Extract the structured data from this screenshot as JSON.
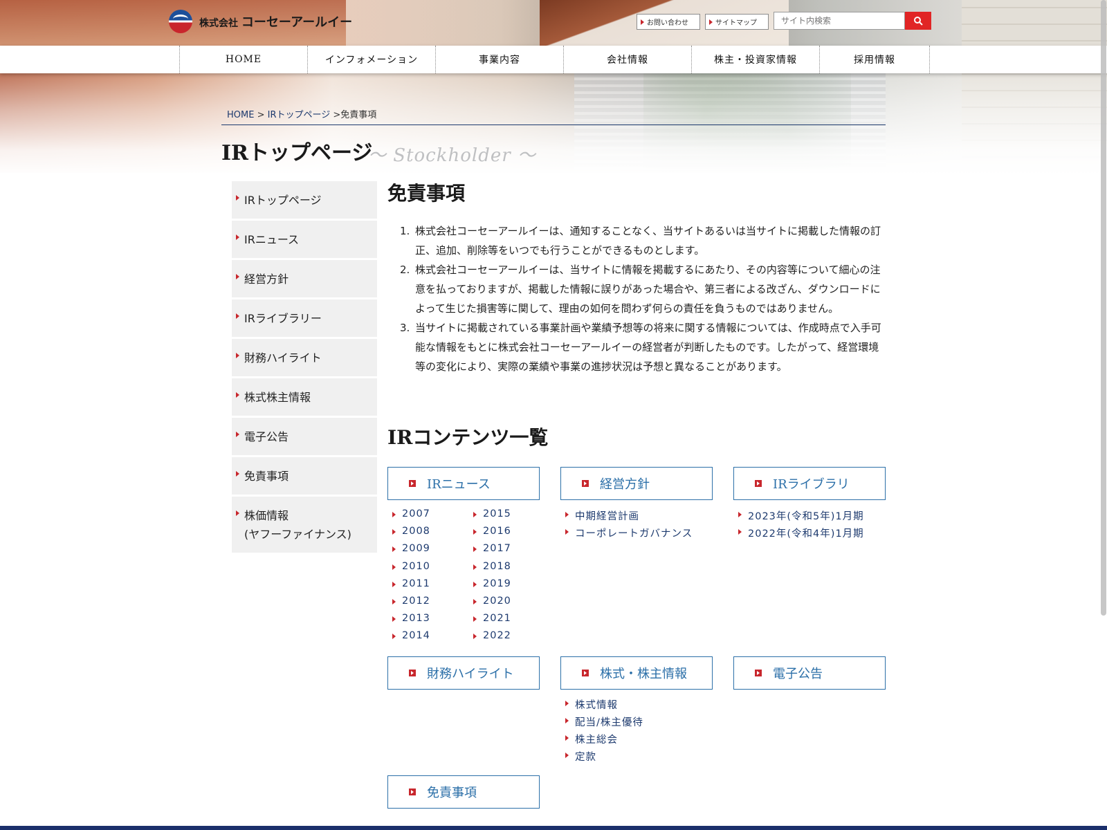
{
  "header": {
    "logo_company_prefix": "株式会社",
    "logo_company_name": "コーセーアールイー",
    "contact_label": "お問い合わせ",
    "sitemap_label": "サイトマップ",
    "search_placeholder": "サイト内検索"
  },
  "nav": [
    "HOME",
    "インフォメーション",
    "事業内容",
    "会社情報",
    "株主・投資家情報",
    "採用情報"
  ],
  "breadcrumb": {
    "home": "HOME",
    "sep1": " > ",
    "ir_top": "IRトップページ",
    "sep2": " >",
    "current": "免責事項"
  },
  "page": {
    "title": "IRトップページ",
    "subtitle": "～ Stockholder ～"
  },
  "side_menu": [
    "IRトップページ",
    "IRニュース",
    "経営方針",
    "IRライブラリー",
    "財務ハイライト",
    "株式株主情報",
    "電子公告",
    "免責事項",
    "株価情報",
    "(ヤフーファイナンス)"
  ],
  "main": {
    "heading": "免責事項",
    "items": [
      {
        "num": "1.",
        "text": "株式会社コーセーアールイーは、通知することなく、当サイトあるいは当サイトに掲載した情報の訂正、追加、削除等をいつでも行うことができるものとします。"
      },
      {
        "num": "2.",
        "text": "株式会社コーセーアールイーは、当サイトに情報を掲載するにあたり、その内容等について細心の注意を払っておりますが、掲載した情報に誤りがあった場合や、第三者による改ざん、ダウンロードによって生じた損害等に関して、理由の如何を問わず何らの責任を負うものではありません。"
      },
      {
        "num": "3.",
        "text": "当サイトに掲載されている事業計画や業績予想等の将来に関する情報については、作成時点で入手可能な情報をもとに株式会社コーセーアールイーの経営者が判断したものです。したがって、経営環境等の変化により、実際の業績や事業の進捗状況は予想と異なることがあります。"
      }
    ],
    "contents_heading": "IRコンテンツ一覧"
  },
  "contents": {
    "ir_news": {
      "title": "IRニュース",
      "years_col1": [
        "2007",
        "2008",
        "2009",
        "2010",
        "2011",
        "2012",
        "2013",
        "2014"
      ],
      "years_col2": [
        "2015",
        "2016",
        "2017",
        "2018",
        "2019",
        "2020",
        "2021",
        "2022"
      ]
    },
    "policy": {
      "title": "経営方針",
      "links": [
        "中期経営計画",
        "コーポレートガバナンス"
      ]
    },
    "library": {
      "title": "IRライブラリ",
      "links": [
        "2023年(令和5年)1月期",
        "2022年(令和4年)1月期"
      ]
    },
    "finance": {
      "title": "財務ハイライト"
    },
    "stock": {
      "title": "株式・株主情報",
      "links": [
        "株式情報",
        "配当/株主優待",
        "株主総会",
        "定款"
      ]
    },
    "notice": {
      "title": "電子公告"
    },
    "disclaimer": {
      "title": "免責事項"
    }
  },
  "colors": {
    "accent_red": "#c8272d",
    "link_blue": "#2b6fa8",
    "nav_navy": "#1b2f6b"
  }
}
